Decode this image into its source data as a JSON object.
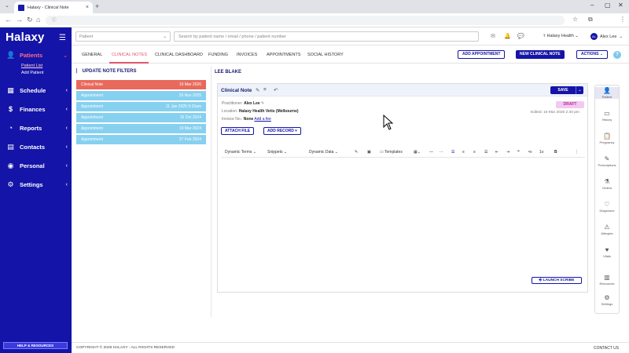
{
  "browser": {
    "tab_title": "Halaxy - Clinical Note",
    "url": "",
    "new_tab": "+",
    "close_tab": "×"
  },
  "sidebar": {
    "logo": "Halaxy",
    "items": [
      {
        "label": "Patients",
        "icon": "user-icon",
        "glyph": "👤",
        "active": true
      },
      {
        "label": "Schedule",
        "icon": "calendar-icon",
        "glyph": "▦"
      },
      {
        "label": "Finances",
        "icon": "dollar-icon",
        "glyph": "$"
      },
      {
        "label": "Reports",
        "icon": "chart-icon",
        "glyph": "◔"
      },
      {
        "label": "Contacts",
        "icon": "contacts-icon",
        "glyph": "▤"
      },
      {
        "label": "Personal",
        "icon": "person-icon",
        "glyph": "◉"
      },
      {
        "label": "Settings",
        "icon": "gear-icon",
        "glyph": "⚙"
      }
    ],
    "sub_items": [
      "Patient List",
      "Add Patient"
    ],
    "help_button": "HELP & RESOURCES"
  },
  "header": {
    "patient_placeholder": "Patient",
    "search_placeholder": "Search by patient name / email / phone / patient number",
    "clinic": "Halaxy Health",
    "user": "Alex Lee",
    "user_initials": "AL"
  },
  "tabs": [
    "GENERAL",
    "CLINICAL NOTES",
    "CLINICAL DASHBOARD",
    "FUNDING",
    "INVOICES",
    "APPOINTMENTS",
    "SOCIAL HISTORY"
  ],
  "active_tab": "CLINICAL NOTES",
  "actions": {
    "add_appointment": "ADD APPOINTMENT",
    "new_clinical_note": "NEW CLINICAL NOTE",
    "actions": "ACTIONS",
    "help": "?"
  },
  "notes_panel": {
    "filters_label": "UPDATE NOTE FILTERS",
    "items": [
      {
        "label": "Clinical Note",
        "date": "16 Mar 2026",
        "type": "clinical"
      },
      {
        "label": "Appointment",
        "date": "29 Nov 2025",
        "type": "appointment"
      },
      {
        "label": "Appointment",
        "date": "11 Jan 2025 9:15am",
        "type": "appointment"
      },
      {
        "label": "Appointment",
        "date": "15 Oct 2024",
        "type": "appointment"
      },
      {
        "label": "Appointment",
        "date": "19 Mar 2024",
        "type": "appointment"
      },
      {
        "label": "Appointment",
        "date": "27 Feb 2024",
        "type": "appointment"
      }
    ]
  },
  "patient": {
    "name": "LEE BLAKE"
  },
  "note": {
    "title": "Clinical Note",
    "save": "SAVE",
    "practitioner_label": "Practitioner:",
    "practitioner": "Alex Lee",
    "location_label": "Location:",
    "location": "Halaxy Health Vetis (Melbourne)",
    "invoice_label": "Invoice No.:",
    "invoice": "None",
    "add_fee": "Add a fee",
    "status": "DRAFT",
    "edited": "Edited: 16 Mar 2026 2:40 pm",
    "attach_file": "ATTACH FILE",
    "add_record": "ADD RECORD",
    "toolbar": {
      "dynamic_terms": "Dynamic Terms",
      "snippets": "Snippets",
      "dynamic_data": "Dynamic Data",
      "templates": "Templates"
    },
    "launch_scribe": "LAUNCH SCRIBE"
  },
  "rail": [
    {
      "label": "Patient",
      "icon": "patient-icon",
      "glyph": "👤",
      "active": true
    },
    {
      "label": "History",
      "icon": "history-icon",
      "glyph": "▭"
    },
    {
      "label": "Pregnancy",
      "icon": "clipboard-icon",
      "glyph": "📋"
    },
    {
      "label": "Prescriptions",
      "icon": "pill-icon",
      "glyph": "✎"
    },
    {
      "label": "Orders",
      "icon": "flask-icon",
      "glyph": "⚗"
    },
    {
      "label": "Diagnoses",
      "icon": "heart-icon",
      "glyph": "♡"
    },
    {
      "label": "Allergies",
      "icon": "allergy-icon",
      "glyph": "⚠"
    },
    {
      "label": "Vitals",
      "icon": "vitals-icon",
      "glyph": "♥"
    },
    {
      "label": "Resources",
      "icon": "books-icon",
      "glyph": "▥"
    },
    {
      "label": "Settings",
      "icon": "gear-icon",
      "glyph": "⚙"
    }
  ],
  "footer": {
    "copyright": "COPYRIGHT © 2026 HALAXY - ALL RIGHTS RESERVED",
    "contact": "CONTACT US"
  },
  "colors": {
    "brand": "#1414a8",
    "accent": "#e0566c",
    "draft": "#f2c9f0",
    "appointment": "#86d0f0",
    "selected_note": "#e86a5c"
  }
}
